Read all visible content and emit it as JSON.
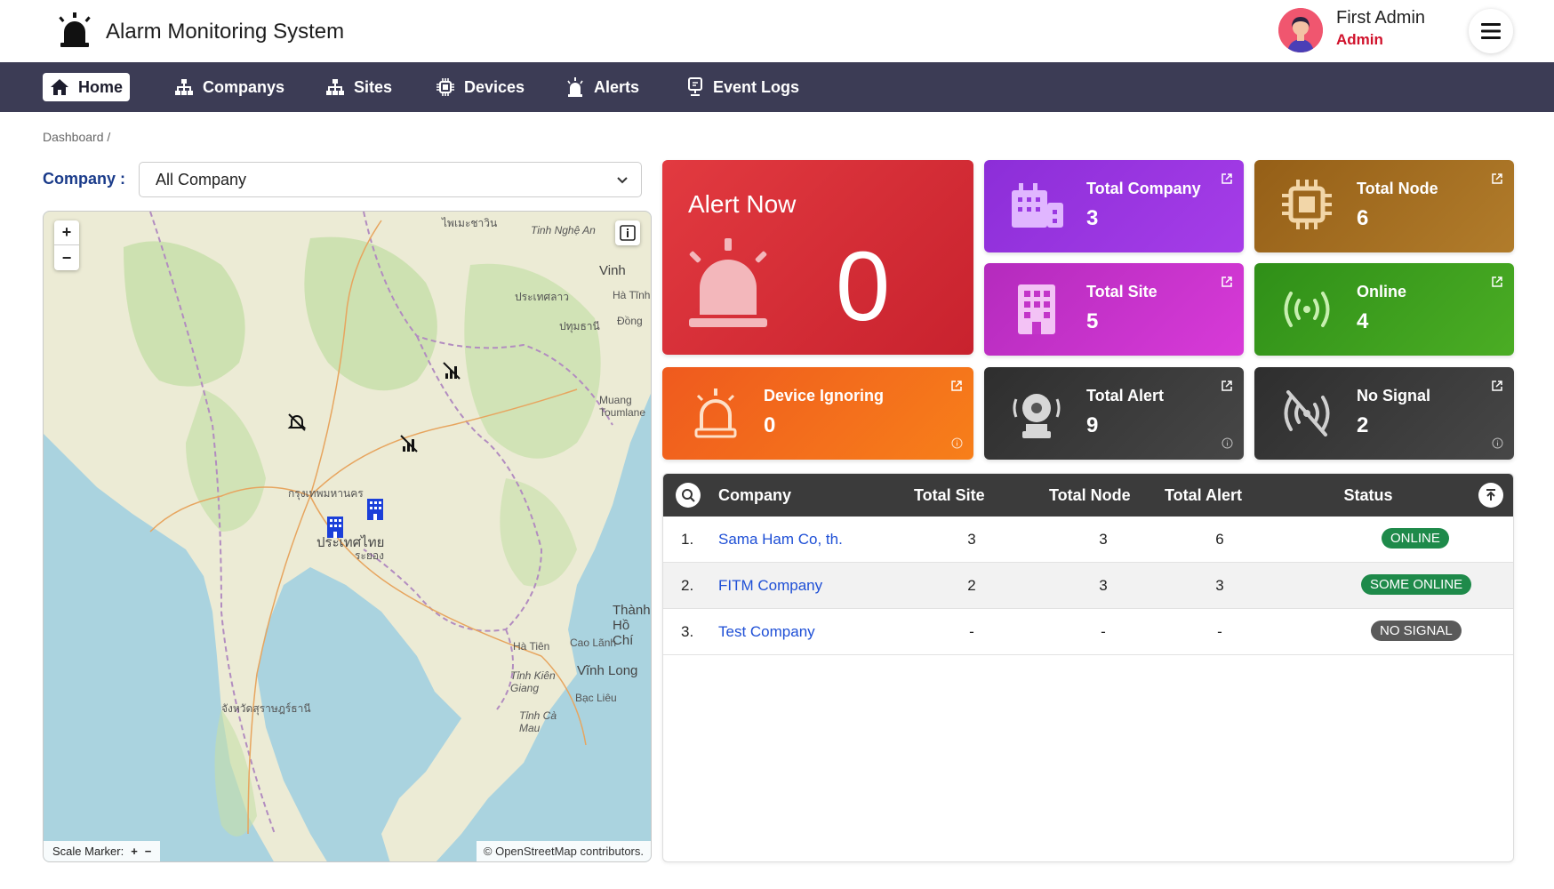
{
  "header": {
    "app_title": "Alarm Monitoring System",
    "user_name": "First Admin",
    "user_role": "Admin"
  },
  "nav": [
    {
      "label": "Home",
      "icon": "home-icon",
      "active": true
    },
    {
      "label": "Companys",
      "icon": "sitemap-icon"
    },
    {
      "label": "Sites",
      "icon": "sitemap-icon"
    },
    {
      "label": "Devices",
      "icon": "chip-icon"
    },
    {
      "label": "Alerts",
      "icon": "siren-icon"
    },
    {
      "label": "Event Logs",
      "icon": "monitor-icon"
    }
  ],
  "breadcrumb": "Dashboard  /",
  "filter": {
    "label": "Company :",
    "selected": "All Company"
  },
  "map": {
    "scale_label": "Scale Marker:",
    "scale_plus": "+",
    "scale_minus": "−",
    "attribution": "© OpenStreetMap contributors.",
    "labels": [
      "ไพเมะชาวิน",
      "Tinh Nghệ An",
      "Vinh",
      "Hà Tĩnh",
      "ประเทศลาว",
      "Đồng",
      "ปทุมธานี",
      "ประเทศไทย",
      "กรุงเทพมหานคร",
      "Thành Hồ Chí",
      "Cao Lãnh",
      "Vĩnh Long",
      "Hà Tiên",
      "Tỉnh Kiên Giang",
      "Bạc Liêu",
      "Tỉnh Cà Mau",
      "Muang Toumlane",
      "ระยอง",
      "จังหวัดสุราษฎร์ธานี"
    ]
  },
  "cards": {
    "alert_now": {
      "title": "Alert Now",
      "value": "0"
    },
    "total_company": {
      "title": "Total Company",
      "value": "3"
    },
    "total_node": {
      "title": "Total Node",
      "value": "6"
    },
    "total_site": {
      "title": "Total Site",
      "value": "5"
    },
    "online": {
      "title": "Online",
      "value": "4"
    },
    "device_ignoring": {
      "title": "Device Ignoring",
      "value": "0"
    },
    "total_alert": {
      "title": "Total Alert",
      "value": "9"
    },
    "no_signal": {
      "title": "No Signal",
      "value": "2"
    }
  },
  "table": {
    "headers": {
      "company": "Company",
      "total_site": "Total Site",
      "total_node": "Total Node",
      "total_alert": "Total Alert",
      "status": "Status"
    },
    "rows": [
      {
        "num": "1.",
        "company": "Sama Ham Co, th.",
        "site": "3",
        "node": "3",
        "alert": "6",
        "status": "ONLINE"
      },
      {
        "num": "2.",
        "company": "FITM Company",
        "site": "2",
        "node": "3",
        "alert": "3",
        "status": "SOME ONLINE"
      },
      {
        "num": "3.",
        "company": "Test Company",
        "site": "-",
        "node": "-",
        "alert": "-",
        "status": "NO SIGNAL"
      }
    ]
  },
  "colors": {
    "nav_bg": "#3c3c55",
    "alert_red": "#d9313a",
    "purple": "#8a2be2",
    "brown": "#a56f1e",
    "magenta": "#c830c8",
    "green": "#3fa31c",
    "orange": "#f06b1c",
    "dark": "#3a3a3a",
    "status_online": "#1e8a4a",
    "status_some_online": "#1e8a4a",
    "status_no_signal": "#5a5a5a"
  }
}
